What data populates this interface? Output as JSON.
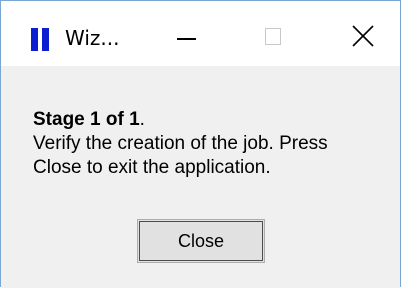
{
  "window": {
    "title": "Wiz...",
    "minimize_symbol": "—",
    "maximize_symbol": "☐",
    "close_symbol": "✕",
    "icon": "pause-bars-icon",
    "accent_color": "#0b1fd1"
  },
  "message": {
    "stage_bold": "Stage 1 of 1",
    "stage_suffix": ".",
    "line1": "Verify the creation of the job. Press",
    "line2": "Close to exit the application."
  },
  "buttons": {
    "close_label": "Close"
  }
}
